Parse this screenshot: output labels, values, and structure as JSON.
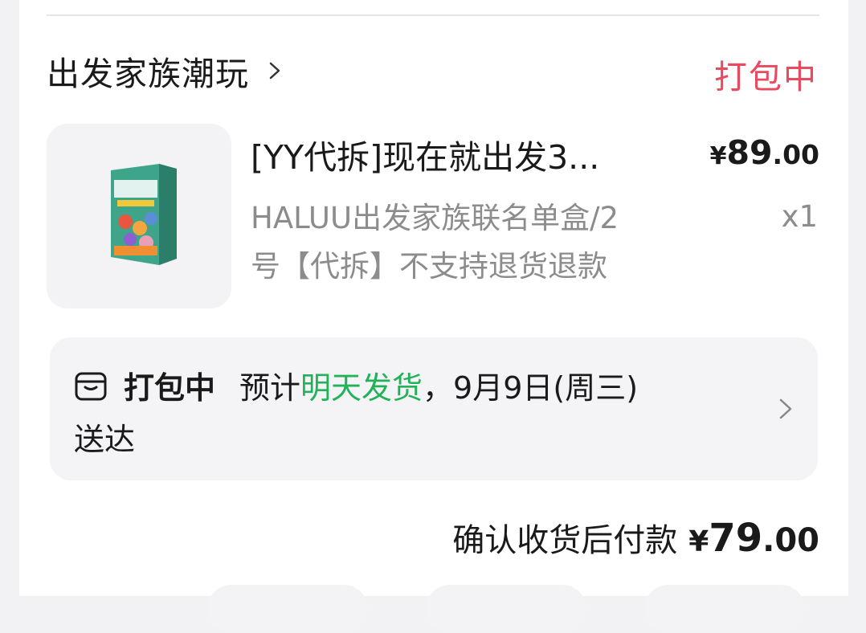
{
  "shop": {
    "name": "出发家族潮玩",
    "status": "打包中"
  },
  "item": {
    "title": "[YY代拆]现在就出发3...",
    "price_symbol": "¥",
    "price_int": "89",
    "price_dec": ".00",
    "spec_line1": "HALUU出发家族联名单盒/2",
    "spec_line2": "号【代拆】不支持退货退款",
    "quantity": "x1"
  },
  "shipping": {
    "status": "打包中",
    "estimate_prefix": "预计",
    "estimate_highlight": "明天发货",
    "estimate_suffix": "，9月9日(周三)",
    "estimate_line2": "送达"
  },
  "payment": {
    "label": "确认收货后付款",
    "price_symbol": "¥",
    "price_int": "79",
    "price_dec": ".00"
  },
  "colors": {
    "status_red": "#e84a5f",
    "highlight_green": "#23b15a"
  },
  "icons": {
    "shop_chevron": "chevron-right-icon",
    "package": "package-box-icon",
    "ship_chevron": "chevron-right-icon"
  }
}
